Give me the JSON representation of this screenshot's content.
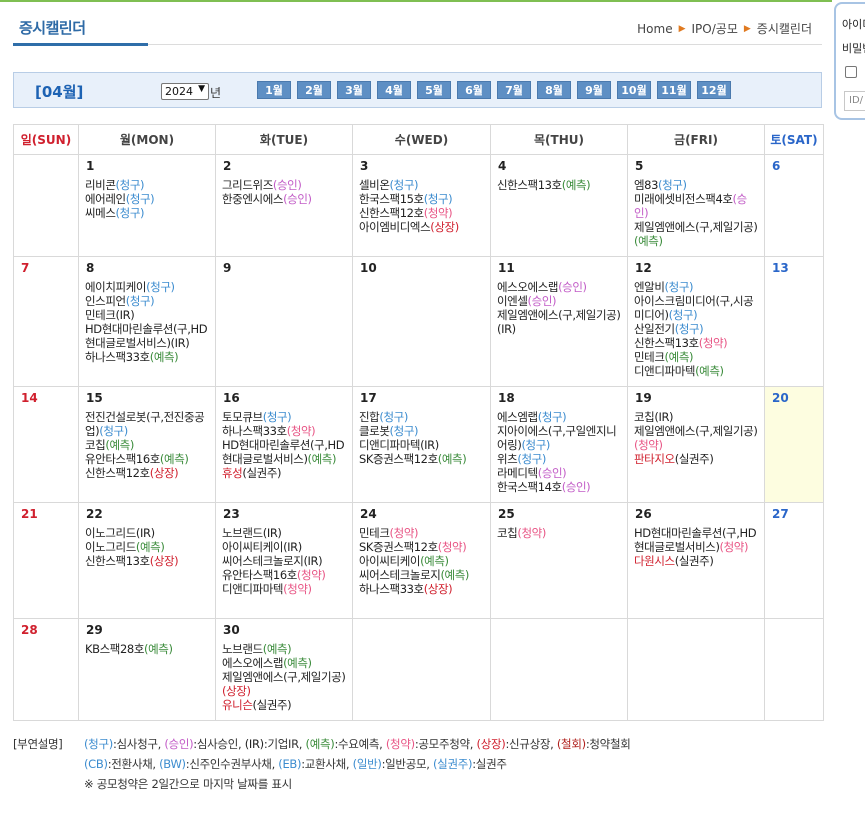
{
  "page": {
    "title": "증시캘린더",
    "breadcrumb": [
      "Home",
      "IPO/공모",
      "증시캘린더"
    ],
    "breadcrumb_sep": "▶"
  },
  "side_panel": {
    "line1": "아이디",
    "line2": "비밀번",
    "id_placeholder": "ID/"
  },
  "month_bar": {
    "month_label": "[04월]",
    "year": "2024",
    "year_suffix": "년",
    "months": [
      "1월",
      "2월",
      "3월",
      "4월",
      "5월",
      "6월",
      "7월",
      "8월",
      "9월",
      "10월",
      "11월",
      "12월"
    ]
  },
  "weekdays": [
    "일(SUN)",
    "월(MON)",
    "화(TUE)",
    "수(WED)",
    "목(THU)",
    "금(FRI)",
    "토(SAT)"
  ],
  "colors": {
    "청구": "#3c8ccf",
    "승인": "#c25cc7",
    "IR": "#222222",
    "예측": "#3a8b3a",
    "청약": "#e85585",
    "상장": "#d0202e",
    "실권주": "#222222"
  },
  "weeks": [
    [
      null,
      {
        "day": "1",
        "events": [
          {
            "name": "리비콘",
            "tag": "(청구)",
            "type": "req"
          },
          {
            "name": "에어레인",
            "tag": "(청구)",
            "type": "req"
          },
          {
            "name": "씨메스",
            "tag": "(청구)",
            "type": "req"
          }
        ]
      },
      {
        "day": "2",
        "events": [
          {
            "name": "그리드위즈",
            "tag": "(승인)",
            "type": "apr"
          },
          {
            "name": "한중엔시에스",
            "tag": "(승인)",
            "type": "apr"
          }
        ]
      },
      {
        "day": "3",
        "events": [
          {
            "name": "셀비온",
            "tag": "(청구)",
            "type": "req"
          },
          {
            "name": "한국스팩15호",
            "tag": "(청구)",
            "type": "req"
          },
          {
            "name": "신한스팩12호",
            "tag": "(청약)",
            "type": "sub"
          },
          {
            "name": "아이엠비디엑스",
            "tag": "(상장)",
            "type": "list"
          }
        ]
      },
      {
        "day": "4",
        "events": [
          {
            "name": "신한스팩13호",
            "tag": "(예측)",
            "type": "fc"
          }
        ]
      },
      {
        "day": "5",
        "events": [
          {
            "name": "엠83",
            "tag": "(청구)",
            "type": "req"
          },
          {
            "name": "미래에셋비전스팩4호",
            "tag": "(승인)",
            "type": "apr"
          },
          {
            "name": "제일엠앤에스(구,제일기공)",
            "tag": "(예측)",
            "type": "fc"
          }
        ]
      },
      {
        "day": "6",
        "events": []
      }
    ],
    [
      {
        "day": "7",
        "events": []
      },
      {
        "day": "8",
        "events": [
          {
            "name": "에이치피케이",
            "tag": "(청구)",
            "type": "req"
          },
          {
            "name": "인스피언",
            "tag": "(청구)",
            "type": "req"
          },
          {
            "name": "민테크",
            "tag": "(IR)",
            "type": "ir"
          },
          {
            "name": "HD현대마린솔루션(구,HD현대글로벌서비스)",
            "tag": "(IR)",
            "type": "ir"
          },
          {
            "name": "하나스팩33호",
            "tag": "(예측)",
            "type": "fc"
          }
        ]
      },
      {
        "day": "9",
        "events": []
      },
      {
        "day": "10",
        "events": []
      },
      {
        "day": "11",
        "events": [
          {
            "name": "에스오에스랩",
            "tag": "(승인)",
            "type": "apr"
          },
          {
            "name": "이엔셀",
            "tag": "(승인)",
            "type": "apr"
          },
          {
            "name": "제일엠앤에스(구,제일기공)",
            "tag": "(IR)",
            "type": "ir"
          }
        ]
      },
      {
        "day": "12",
        "events": [
          {
            "name": "엔알비",
            "tag": "(청구)",
            "type": "req"
          },
          {
            "name": "아이스크림미디어(구,시공미디어)",
            "tag": "(청구)",
            "type": "req"
          },
          {
            "name": "산일전기",
            "tag": "(청구)",
            "type": "req"
          },
          {
            "name": "신한스팩13호",
            "tag": "(청약)",
            "type": "sub"
          },
          {
            "name": "민테크",
            "tag": "(예측)",
            "type": "fc"
          },
          {
            "name": "디앤디파마텍",
            "tag": "(예측)",
            "type": "fc"
          }
        ]
      },
      {
        "day": "13",
        "events": []
      }
    ],
    [
      {
        "day": "14",
        "events": []
      },
      {
        "day": "15",
        "events": [
          {
            "name": "전진건설로봇(구,전진중공업)",
            "tag": "(청구)",
            "type": "req"
          },
          {
            "name": "코칩",
            "tag": "(예측)",
            "type": "fc"
          },
          {
            "name": "유안타스팩16호",
            "tag": "(예측)",
            "type": "fc"
          },
          {
            "name": "신한스팩12호",
            "tag": "(상장)",
            "type": "list"
          }
        ]
      },
      {
        "day": "16",
        "events": [
          {
            "name": "토모큐브",
            "tag": "(청구)",
            "type": "req"
          },
          {
            "name": "하나스팩33호",
            "tag": "(청약)",
            "type": "sub"
          },
          {
            "name": "HD현대마린솔루션(구,HD현대글로벌서비스)",
            "tag": "(예측)",
            "type": "fc"
          },
          {
            "name": "휴성",
            "tag": "(실권주)",
            "type": "rt",
            "red": true
          }
        ]
      },
      {
        "day": "17",
        "events": [
          {
            "name": "진합",
            "tag": "(청구)",
            "type": "req"
          },
          {
            "name": "클로봇",
            "tag": "(청구)",
            "type": "req"
          },
          {
            "name": "디앤디파마텍",
            "tag": "(IR)",
            "type": "ir"
          },
          {
            "name": "SK증권스팩12호",
            "tag": "(예측)",
            "type": "fc"
          }
        ]
      },
      {
        "day": "18",
        "events": [
          {
            "name": "에스엠랩",
            "tag": "(청구)",
            "type": "req"
          },
          {
            "name": "지아이에스(구,구일엔지니어링)",
            "tag": "(청구)",
            "type": "req"
          },
          {
            "name": "위츠",
            "tag": "(청구)",
            "type": "req"
          },
          {
            "name": "라메디텍",
            "tag": "(승인)",
            "type": "apr"
          },
          {
            "name": "한국스팩14호",
            "tag": "(승인)",
            "type": "apr"
          }
        ]
      },
      {
        "day": "19",
        "events": [
          {
            "name": "코칩",
            "tag": "(IR)",
            "type": "ir"
          },
          {
            "name": "제일엠앤에스(구,제일기공)",
            "tag": "(청약)",
            "type": "sub"
          },
          {
            "name": "판타지오",
            "tag": "(실권주)",
            "type": "rt",
            "red": true
          }
        ]
      },
      {
        "day": "20",
        "events": [],
        "today": true
      }
    ],
    [
      {
        "day": "21",
        "events": []
      },
      {
        "day": "22",
        "events": [
          {
            "name": "이노그리드",
            "tag": "(IR)",
            "type": "ir"
          },
          {
            "name": "이노그리드",
            "tag": "(예측)",
            "type": "fc"
          },
          {
            "name": "신한스팩13호",
            "tag": "(상장)",
            "type": "list"
          }
        ]
      },
      {
        "day": "23",
        "events": [
          {
            "name": "노브랜드",
            "tag": "(IR)",
            "type": "ir"
          },
          {
            "name": "아이씨티케이",
            "tag": "(IR)",
            "type": "ir"
          },
          {
            "name": "씨어스테크놀로지",
            "tag": "(IR)",
            "type": "ir"
          },
          {
            "name": "유안타스팩16호",
            "tag": "(청약)",
            "type": "sub"
          },
          {
            "name": "디앤디파마텍",
            "tag": "(청약)",
            "type": "sub"
          }
        ]
      },
      {
        "day": "24",
        "events": [
          {
            "name": "민테크",
            "tag": "(청약)",
            "type": "sub"
          },
          {
            "name": "SK증권스팩12호",
            "tag": "(청약)",
            "type": "sub"
          },
          {
            "name": "아이씨티케이",
            "tag": "(예측)",
            "type": "fc"
          },
          {
            "name": "씨어스테크놀로지",
            "tag": "(예측)",
            "type": "fc"
          },
          {
            "name": "하나스팩33호",
            "tag": "(상장)",
            "type": "list"
          }
        ]
      },
      {
        "day": "25",
        "events": [
          {
            "name": "코칩",
            "tag": "(청약)",
            "type": "sub"
          }
        ]
      },
      {
        "day": "26",
        "events": [
          {
            "name": "HD현대마린솔루션(구,HD현대글로벌서비스)",
            "tag": "(청약)",
            "type": "sub"
          },
          {
            "name": "다원시스",
            "tag": "(실권주)",
            "type": "rt",
            "red": true
          }
        ]
      },
      {
        "day": "27",
        "events": []
      }
    ],
    [
      {
        "day": "28",
        "events": []
      },
      {
        "day": "29",
        "events": [
          {
            "name": "KB스팩28호",
            "tag": "(예측)",
            "type": "fc"
          }
        ]
      },
      {
        "day": "30",
        "events": [
          {
            "name": "노브랜드",
            "tag": "(예측)",
            "type": "fc"
          },
          {
            "name": "에스오에스랩",
            "tag": "(예측)",
            "type": "fc"
          },
          {
            "name": "제일엠앤에스(구,제일기공)",
            "tag": "(상장)",
            "type": "list"
          },
          {
            "name": "유니슨",
            "tag": "(실권주)",
            "type": "rt",
            "red": true
          }
        ]
      },
      null,
      null,
      null,
      null
    ]
  ],
  "legend": {
    "label": "[부연설명]",
    "row1": [
      {
        "tag": "(청구)",
        "type": "req",
        "desc": ":심사청구,"
      },
      {
        "tag": "(승인)",
        "type": "apr",
        "desc": ":심사승인,"
      },
      {
        "tag": "(IR)",
        "type": "ir",
        "desc": ":기업IR,"
      },
      {
        "tag": "(예측)",
        "type": "fc",
        "desc": ":수요예측,"
      },
      {
        "tag": "(청약)",
        "type": "sub",
        "desc": ":공모주청약,"
      },
      {
        "tag": "(상장)",
        "type": "list",
        "desc": ":신규상장,"
      },
      {
        "tag": "(철회)",
        "type": "wd",
        "desc": ":청약철회"
      }
    ],
    "row2": [
      {
        "tag": "(CB)",
        "type": "req",
        "desc": ":전환사채,"
      },
      {
        "tag": "(BW)",
        "type": "req",
        "desc": ":신주인수권부사채,"
      },
      {
        "tag": "(EB)",
        "type": "req",
        "desc": ":교환사채,"
      },
      {
        "tag": "(일반)",
        "type": "req",
        "desc": ":일반공모,"
      },
      {
        "tag": "(실권주)",
        "type": "req",
        "desc": ":실권주"
      }
    ],
    "note": "※ 공모청약은 2일간으로 마지막 날짜를 표시"
  }
}
